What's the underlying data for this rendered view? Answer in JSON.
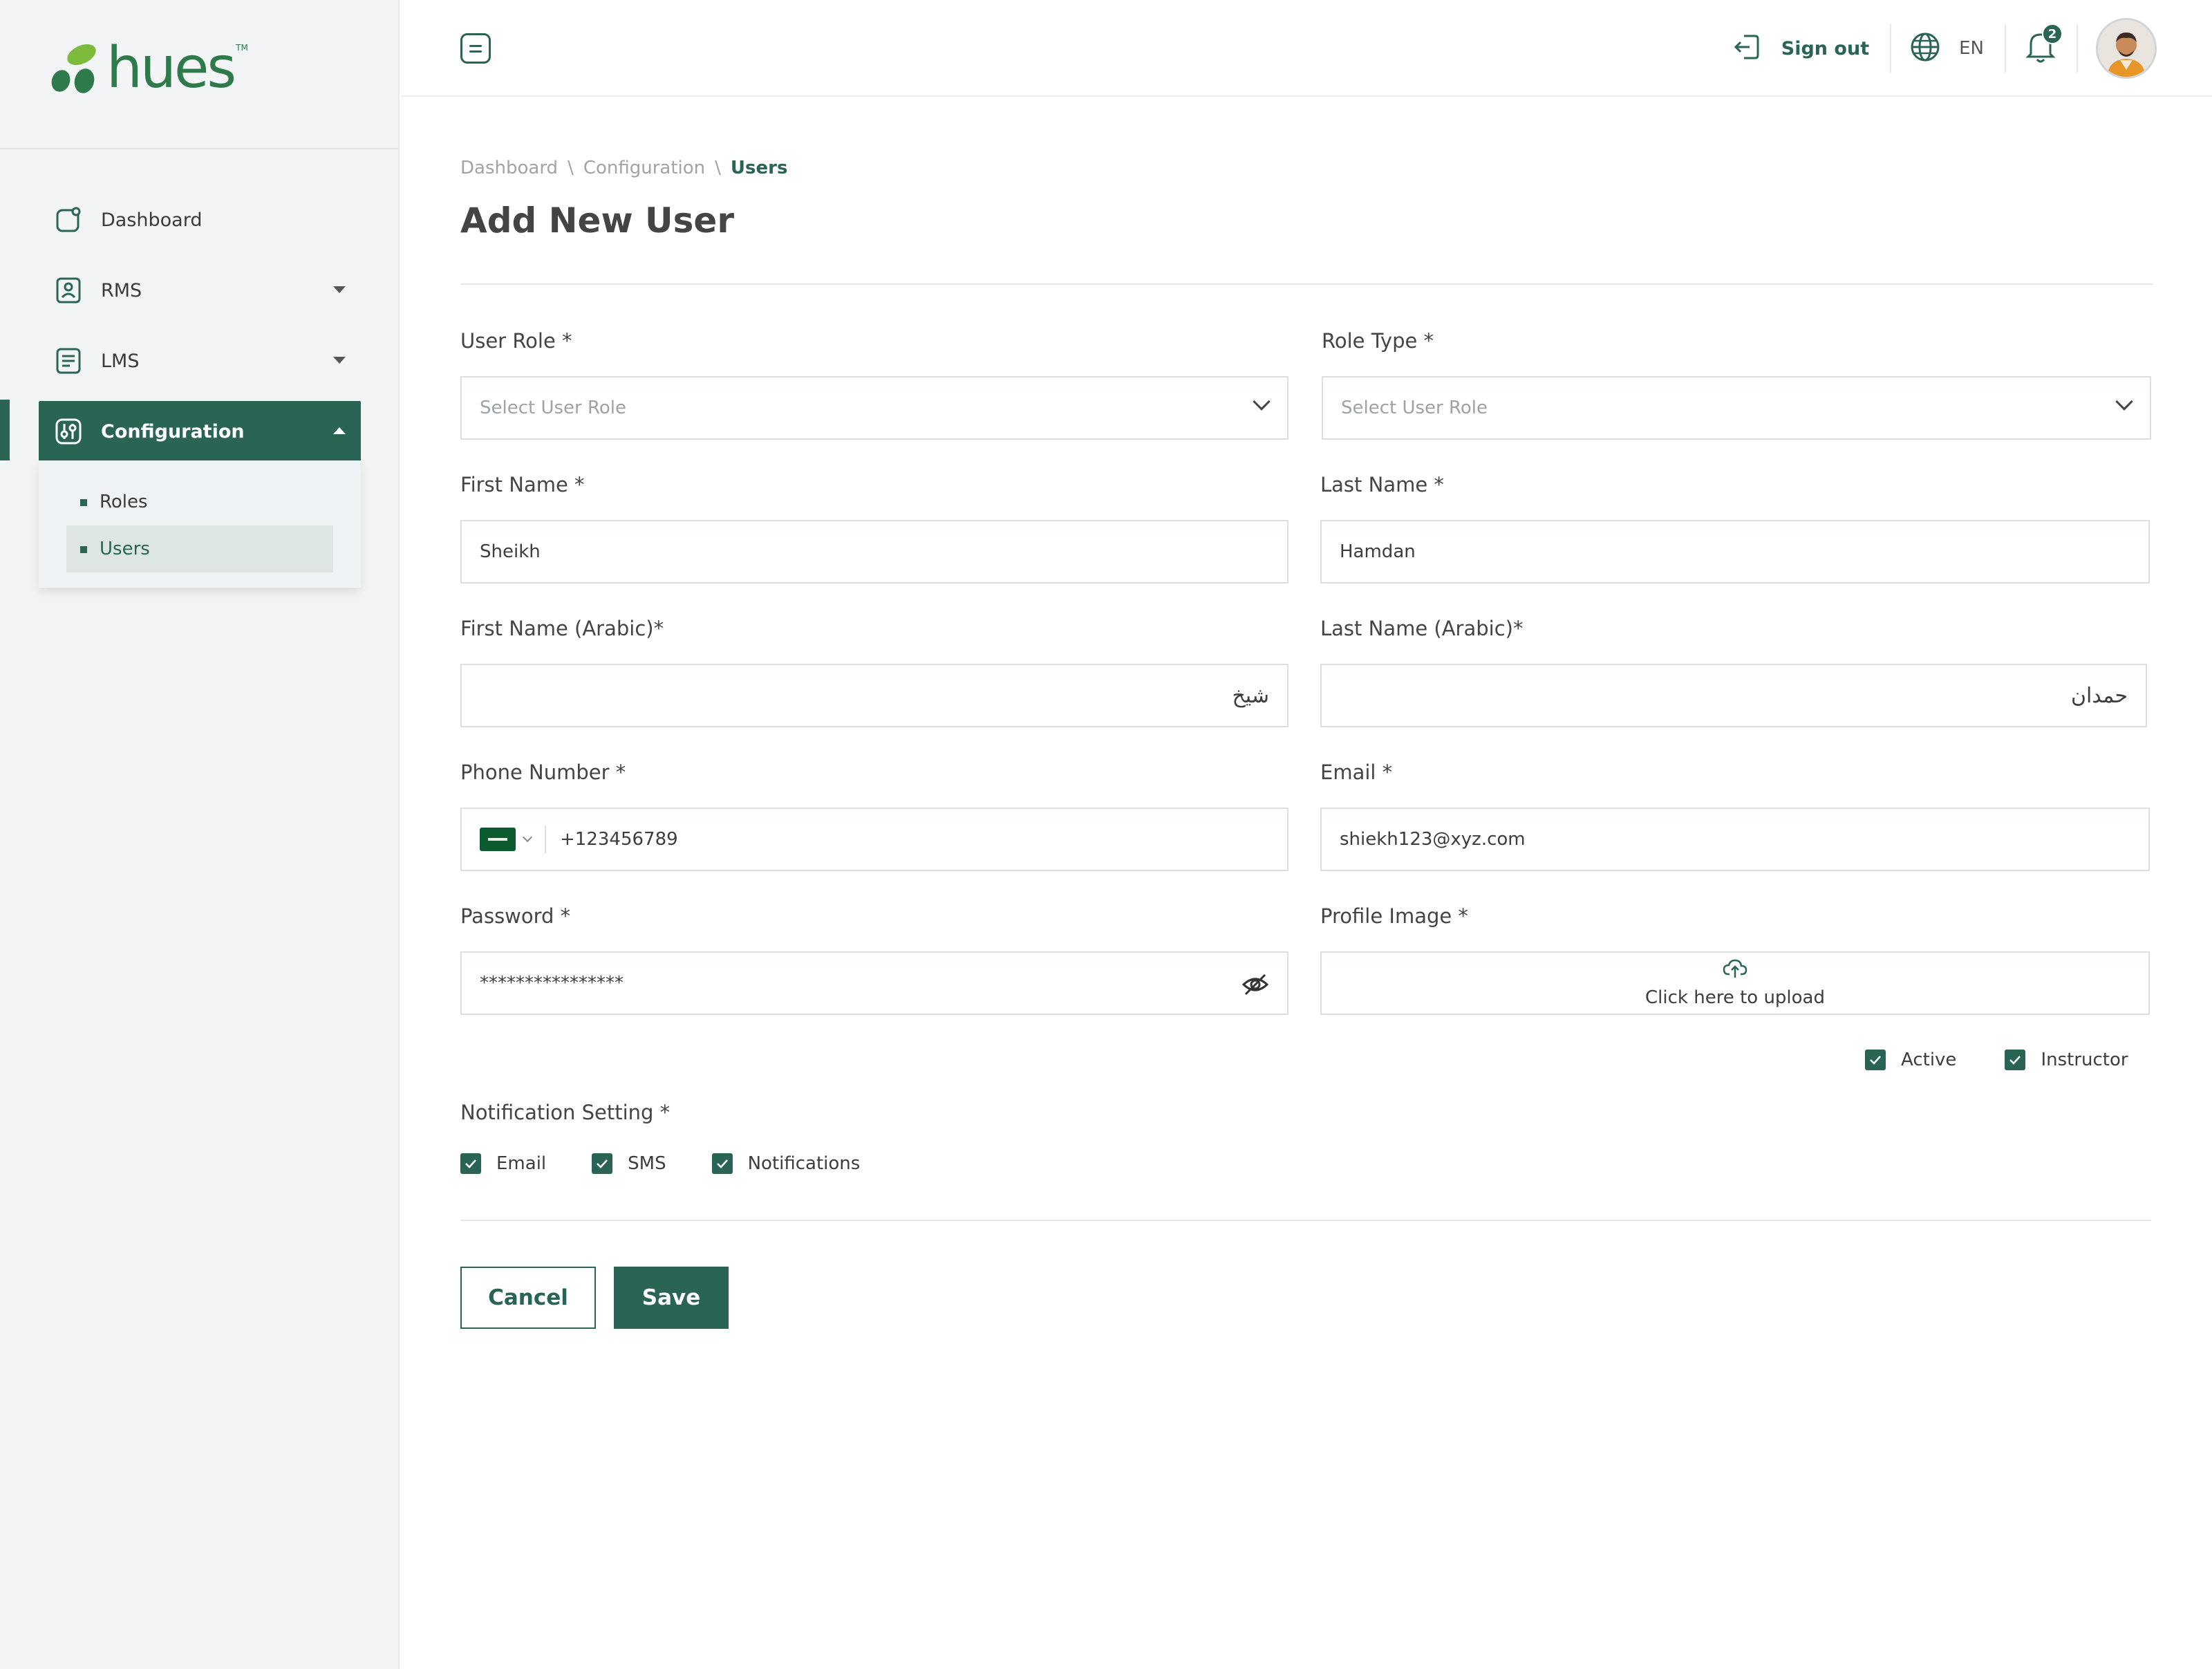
{
  "brand": {
    "name": "hues",
    "tm": "TM",
    "colors": {
      "primary": "#2a6454",
      "logo_green": "#2f7a4a",
      "logo_light": "#7dbb3c"
    }
  },
  "sidebar": {
    "items": [
      {
        "label": "Dashboard",
        "icon": "dashboard-icon"
      },
      {
        "label": "RMS",
        "icon": "rms-icon"
      },
      {
        "label": "LMS",
        "icon": "lms-icon"
      },
      {
        "label": "Configuration",
        "icon": "configuration-icon"
      }
    ],
    "submenu": [
      {
        "label": "Roles"
      },
      {
        "label": "Users"
      }
    ]
  },
  "header": {
    "sign_out": "Sign out",
    "language": "EN",
    "notification_count": "2"
  },
  "breadcrumb": {
    "item1": "Dashboard",
    "sep1": "\\",
    "item2": "Configuration",
    "sep2": "\\",
    "current": "Users"
  },
  "page": {
    "title": "Add New User"
  },
  "form": {
    "user_role": {
      "label": "User Role *",
      "placeholder": "Select User Role"
    },
    "role_type": {
      "label": "Role Type *",
      "placeholder": "Select User Role"
    },
    "first_name": {
      "label": "First Name *",
      "value": "Sheikh"
    },
    "last_name": {
      "label": "Last Name *",
      "value": "Hamdan"
    },
    "first_name_ar": {
      "label": "First Name (Arabic)*",
      "value": "شيخ"
    },
    "last_name_ar": {
      "label": "Last Name (Arabic)*",
      "value": "حمدان"
    },
    "phone": {
      "label": "Phone Number *",
      "value": "+123456789"
    },
    "email": {
      "label": "Email *",
      "value": "shiekh123@xyz.com"
    },
    "password": {
      "label": "Password *",
      "value": "****************"
    },
    "profile_image": {
      "label": "Profile Image *",
      "upload_text": "Click here to upload"
    },
    "active": {
      "label": "Active",
      "checked": true
    },
    "instructor": {
      "label": "Instructor",
      "checked": true
    },
    "notification_setting": {
      "label": "Notification Setting *",
      "options": [
        {
          "label": "Email",
          "checked": true
        },
        {
          "label": "SMS",
          "checked": true
        },
        {
          "label": "Notifications",
          "checked": true
        }
      ]
    }
  },
  "actions": {
    "cancel": "Cancel",
    "save": "Save"
  }
}
